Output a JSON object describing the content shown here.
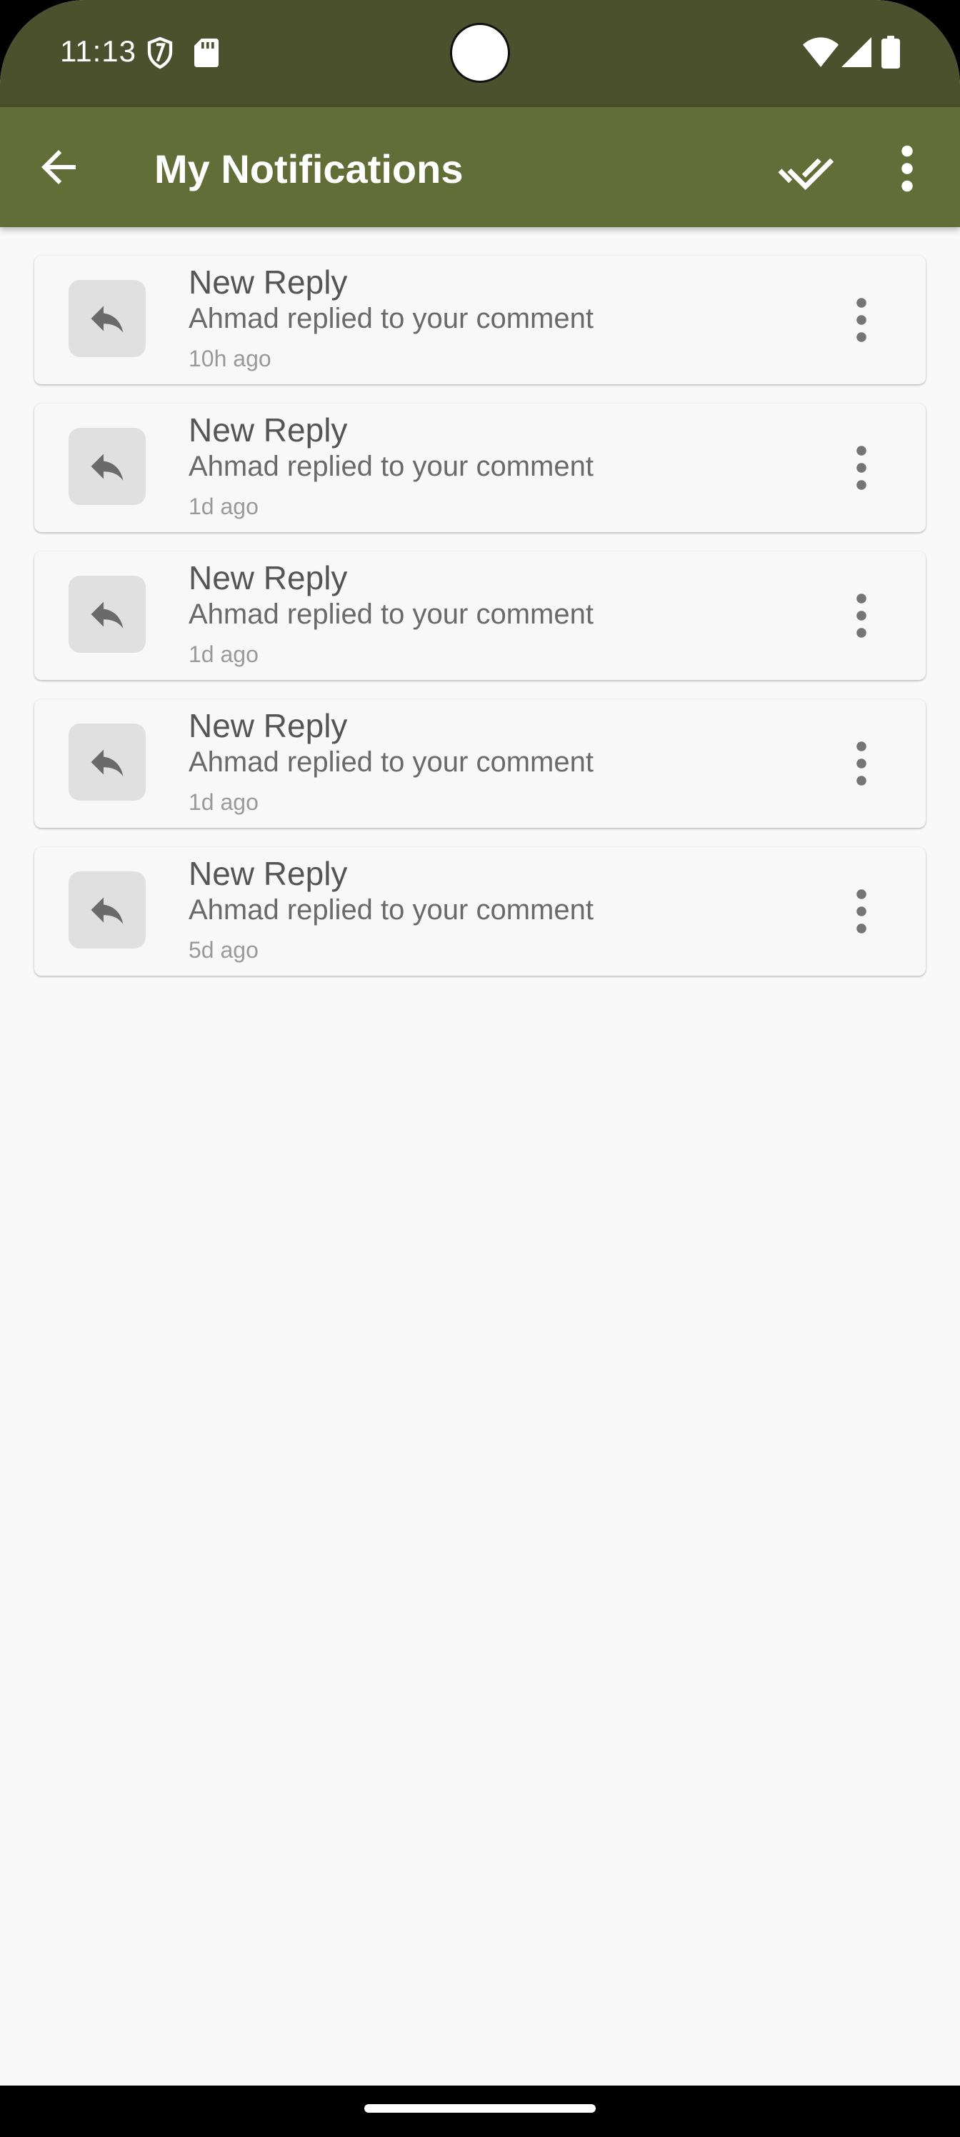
{
  "status_bar": {
    "time": "11:13",
    "icons": [
      "vpn-shield-icon",
      "sd-card-icon",
      "wifi-icon",
      "cell-signal-icon",
      "battery-icon"
    ]
  },
  "app_bar": {
    "title": "My Notifications",
    "back_icon": "arrow-back-icon",
    "mark_all_read_icon": "double-check-icon",
    "overflow_icon": "more-vert-icon",
    "background": "#616e37",
    "status_background": "#4b512c"
  },
  "notifications": [
    {
      "title": "New Reply",
      "body": "Ahmad replied to your comment",
      "time": "10h ago",
      "icon": "reply-icon"
    },
    {
      "title": "New Reply",
      "body": "Ahmad replied to your comment",
      "time": "1d ago",
      "icon": "reply-icon"
    },
    {
      "title": "New Reply",
      "body": "Ahmad replied to your comment",
      "time": "1d ago",
      "icon": "reply-icon"
    },
    {
      "title": "New Reply",
      "body": "Ahmad replied to your comment",
      "time": "1d ago",
      "icon": "reply-icon"
    },
    {
      "title": "New Reply",
      "body": "Ahmad replied to your comment",
      "time": "5d ago",
      "icon": "reply-icon"
    }
  ]
}
